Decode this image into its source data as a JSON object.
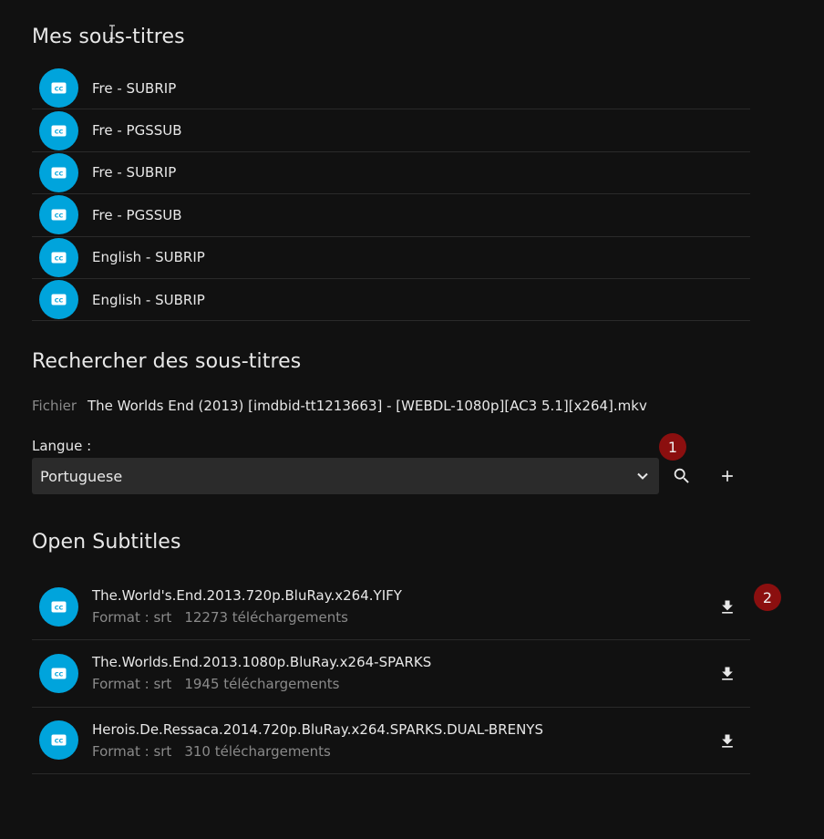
{
  "my_subtitles": {
    "title": "Mes sous-titres",
    "items": [
      {
        "label": "Fre - SUBRIP"
      },
      {
        "label": "Fre - PGSSUB"
      },
      {
        "label": "Fre - SUBRIP"
      },
      {
        "label": "Fre - PGSSUB"
      },
      {
        "label": "English - SUBRIP"
      },
      {
        "label": "English - SUBRIP"
      }
    ]
  },
  "search": {
    "title": "Rechercher des sous-titres",
    "file_key": "Fichier",
    "file_value": "The Worlds End (2013) [imdbid-tt1213663] - [WEBDL-1080p][AC3 5.1][x264].mkv",
    "language_label": "Langue :",
    "language_value": "Portuguese",
    "icons": {
      "search": "search-icon",
      "add": "plus-icon",
      "dropdown": "chevron-down-icon"
    }
  },
  "markers": {
    "one": "1",
    "two": "2"
  },
  "open_subtitles": {
    "title": "Open Subtitles",
    "results": [
      {
        "name": "The.World's.End.2013.720p.BluRay.x264.YIFY",
        "format": "Format : srt",
        "downloads": "12273 téléchargements"
      },
      {
        "name": "The.Worlds.End.2013.1080p.BluRay.x264-SPARKS",
        "format": "Format : srt",
        "downloads": "1945 téléchargements"
      },
      {
        "name": "Herois.De.Ressaca.2014.720p.BluRay.x264.SPARKS.DUAL-BRENYS",
        "format": "Format : srt",
        "downloads": "310 téléchargements"
      }
    ]
  },
  "colors": {
    "background": "#111111",
    "accent": "#00a4dc",
    "marker": "#8b0f0f",
    "select_bg": "#2b2b2b"
  }
}
